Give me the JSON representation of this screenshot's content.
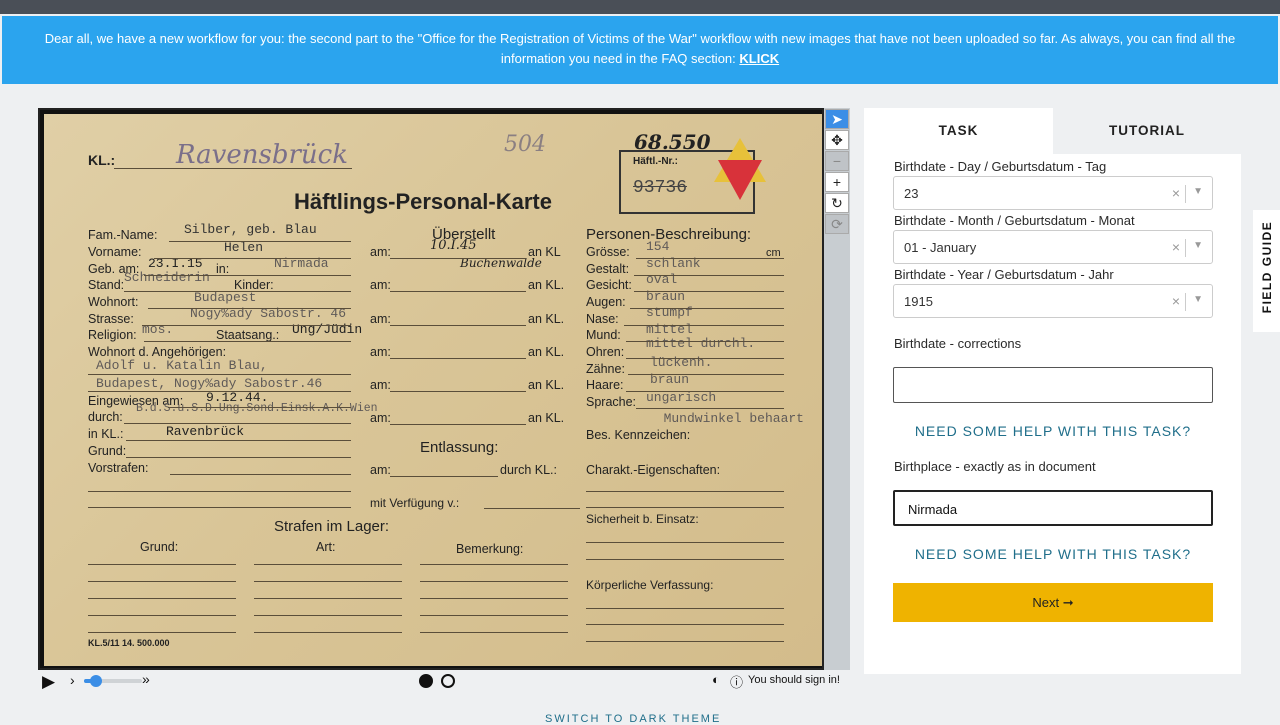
{
  "banner": {
    "text": "Dear all, we have a new workflow for you: the second part to the \"Office for the Registration of Victims of the War\" workflow with new images that have not been uploaded so far. As always, you can find all the information you need in the FAQ section: ",
    "link": "KLICK"
  },
  "card": {
    "kl_label": "KL.:",
    "kl_hand": "Ravensbrück",
    "num_504": "504",
    "num_68550": "68.550",
    "haeftl_nr": "Häftl.-Nr.:",
    "crossed_num": "93736",
    "title": "Häftlings-Personal-Karte",
    "fam_name": "Fam.-Name:",
    "fam_value": "Silber, geb. Blau",
    "vorname": "Vorname:",
    "vorname_value": "Helen",
    "geb_am": "Geb. am:",
    "geb_value": "23.I.15",
    "in": "in:",
    "in_value": "Nirmada",
    "stand": "Stand:",
    "stand_value": "Schneiderin",
    "kinder": "Kinder:",
    "wohnort": "Wohnort:",
    "wohnort_value": "Budapest",
    "strasse": "Strasse:",
    "strasse_value": "Nogy%ady Sabostr. 46",
    "religion": "Religion:",
    "religion_value": "mos.",
    "staatsang": "Staatsang.:",
    "staatsang_value": "Ung/Jüdin",
    "wohnort_ang": "Wohnort d. Angehörigen:",
    "ang1": "Adolf u. Katalin Blau,",
    "ang2": "Budapest, Nogy%ady Sabostr.46",
    "eingewiesen": "Eingewiesen am:",
    "eingewiesen_value": "9.12.44.",
    "durch": "durch:",
    "durch_value": "B.d.S.u.S.D.Ung.Sond.Einsk.A.K.Wien",
    "in_kl": "in KL.:",
    "in_kl_value": "Ravenbrück",
    "grund": "Grund:",
    "vorstrafen": "Vorstrafen:",
    "ueberstellt": "Überstellt",
    "am": "am:",
    "an_kl": "an KL",
    "an_kl2": "an KL.",
    "am_value": "10.I.45",
    "an_kl_value": "Buchenwalde",
    "entlassung": "Entlassung:",
    "durch_kl": "durch KL.:",
    "mit_verfuegung": "mit Verfügung v.:",
    "personen": "Personen-Beschreibung:",
    "groesse": "Grösse:",
    "groesse_value": "154",
    "cm": "cm",
    "gestalt": "Gestalt:",
    "gestalt_value": "schlank",
    "gesicht": "Gesicht:",
    "gesicht_value": "oval",
    "augen": "Augen:",
    "augen_value": "braun",
    "nase": "Nase:",
    "nase_value": "stumpf",
    "mund": "Mund:",
    "mund_value": "mittel",
    "ohren": "Ohren:",
    "ohren_value": "mittel durchl.",
    "zaehne": "Zähne:",
    "zaehne_value": "lückenh.",
    "haare": "Haare:",
    "haare_value": "braun",
    "sprache": "Sprache:",
    "sprache_value": "ungarisch",
    "bes_kenn": "Bes. Kennzeichen:",
    "bes_kenn_value": "Mundwinkel behaart",
    "charakt": "Charakt.-Eigenschaften:",
    "sicherheit": "Sicherheit b. Einsatz:",
    "koerper": "Körperliche Verfassung:",
    "strafen": "Strafen im Lager:",
    "grund_col": "Grund:",
    "art_col": "Art:",
    "bemerkung_col": "Bemerkung:",
    "footer": "KL.5/11 14.  500.000"
  },
  "tools": [
    "pointer-icon",
    "move-icon",
    "zoom-out-icon",
    "zoom-in-icon",
    "rotate-icon",
    "reset-icon"
  ],
  "controls": {
    "speed_fraction": 0.2,
    "signin": "You should sign in!"
  },
  "panel": {
    "tab_task": "TASK",
    "tab_tutorial": "TUTORIAL",
    "day_label": "Birthdate - Day / Geburtsdatum - Tag",
    "day_value": "23",
    "month_label": "Birthdate - Month / Geburtsdatum - Monat",
    "month_value": "01 - January",
    "year_label": "Birthdate - Year / Geburtsdatum - Jahr",
    "year_value": "1915",
    "corrections_label": "Birthdate - corrections",
    "corrections_value": "",
    "help1": "NEED SOME HELP WITH THIS TASK?",
    "birthplace_label": "Birthplace - exactly as in document",
    "birthplace_value": "Nirmada",
    "help2": "NEED SOME HELP WITH THIS TASK?",
    "next": "Next ➞"
  },
  "field_guide": "FIELD GUIDE",
  "dark_theme": "SWITCH TO DARK THEME",
  "colors": {
    "banner": "#2ba4ee",
    "next_button": "#efb300",
    "help_link": "#1f6e8a",
    "tool_active": "#3b8ee6"
  }
}
